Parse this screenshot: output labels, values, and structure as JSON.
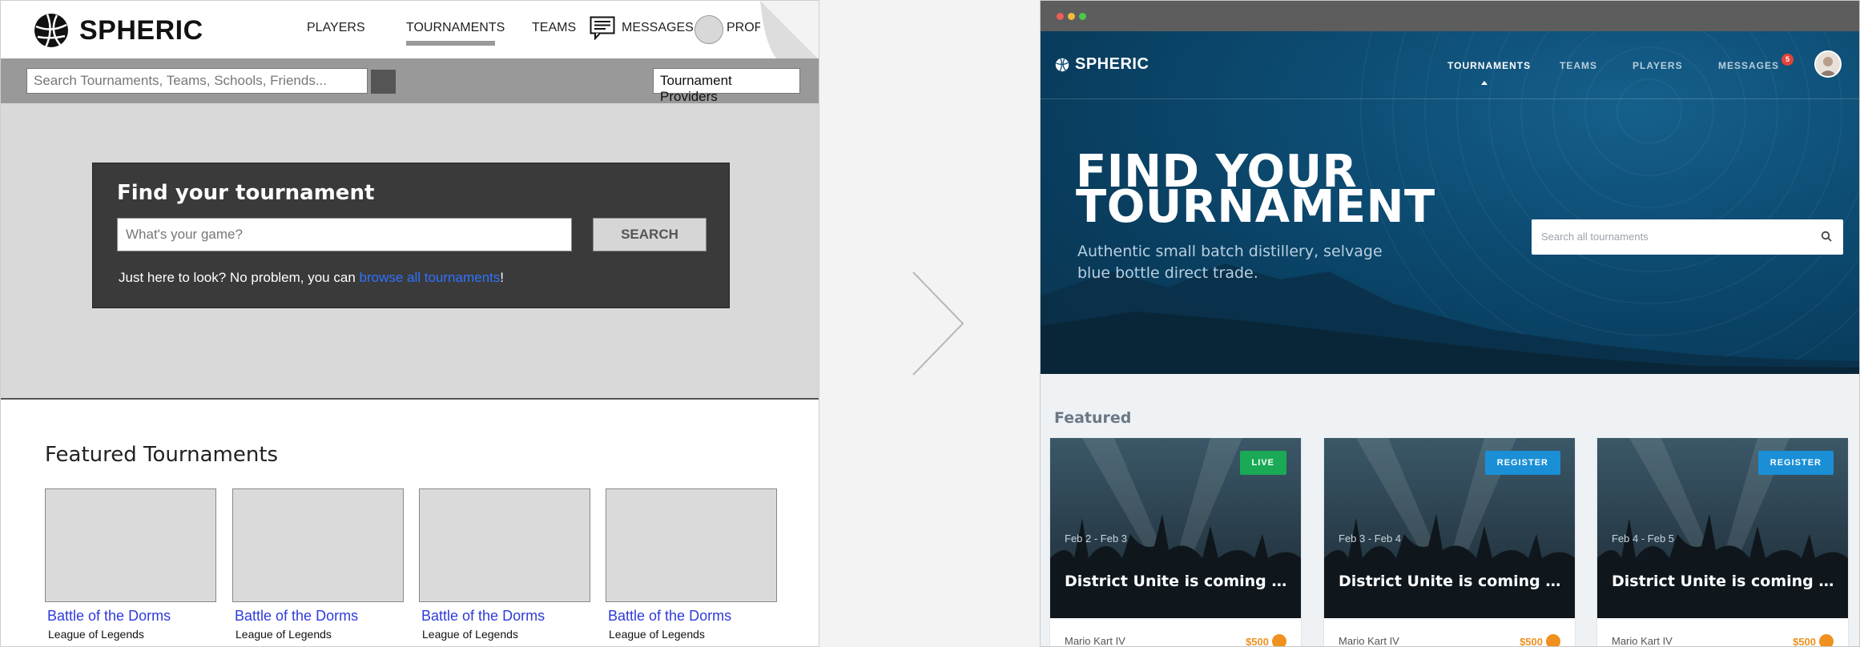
{
  "wireframe": {
    "logo": "SPHERIC",
    "nav": {
      "players": "PLAYERS",
      "tournaments": "TOURNAMENTS",
      "teams": "TEAMS",
      "messages": "MESSAGES",
      "profile": "PROFI"
    },
    "search_placeholder": "Search Tournaments, Teams, Schools, Friends...",
    "providers_label": "Tournament Providers",
    "hero": {
      "title": "Find your tournament",
      "input_placeholder": "What's your game?",
      "button": "SEARCH",
      "note_prefix": "Just here to look? No problem, you can ",
      "note_link": "browse all tournaments",
      "note_suffix": "!"
    },
    "featured_title": "Featured Tournaments",
    "cards": [
      {
        "title": "Battle of the Dorms",
        "subtitle": "League of Legends"
      },
      {
        "title": "Battle of the Dorms",
        "subtitle": "League of Legends"
      },
      {
        "title": "Battle of the Dorms",
        "subtitle": "League of Legends"
      },
      {
        "title": "Battle of the Dorms",
        "subtitle": "League of Legends"
      }
    ]
  },
  "design": {
    "logo": "SPHERIC",
    "nav": {
      "tournaments": "TOURNAMENTS",
      "teams": "TEAMS",
      "players": "PLAYERS",
      "messages": "MESSAGES",
      "messages_badge": "5"
    },
    "hero": {
      "title": "FIND YOUR TOURNAMENT",
      "subtitle": "Authentic small batch distillery, selvage blue bottle direct trade.",
      "search_placeholder": "Search all tournaments"
    },
    "featured_title": "Featured",
    "cards": [
      {
        "tag": "LIVE",
        "tag_color": "#1aaa55",
        "dates": "Feb 2 - Feb 3",
        "title": "District Unite is coming to your...",
        "game": "Mario Kart IV",
        "prize": "$500"
      },
      {
        "tag": "REGISTER",
        "tag_color": "#1a8fd6",
        "dates": "Feb 3 - Feb 4",
        "title": "District Unite is coming to your...",
        "game": "Mario Kart IV",
        "prize": "$500"
      },
      {
        "tag": "REGISTER",
        "tag_color": "#1a8fd6",
        "dates": "Feb 4 - Feb 5",
        "title": "District Unite is coming to your...",
        "game": "Mario Kart IV",
        "prize": "$500"
      }
    ],
    "colors": {
      "hero_bg": "#0d4d74",
      "prize": "#f0901e",
      "badge": "#e5433b",
      "body_bg": "#eef2f5"
    }
  }
}
